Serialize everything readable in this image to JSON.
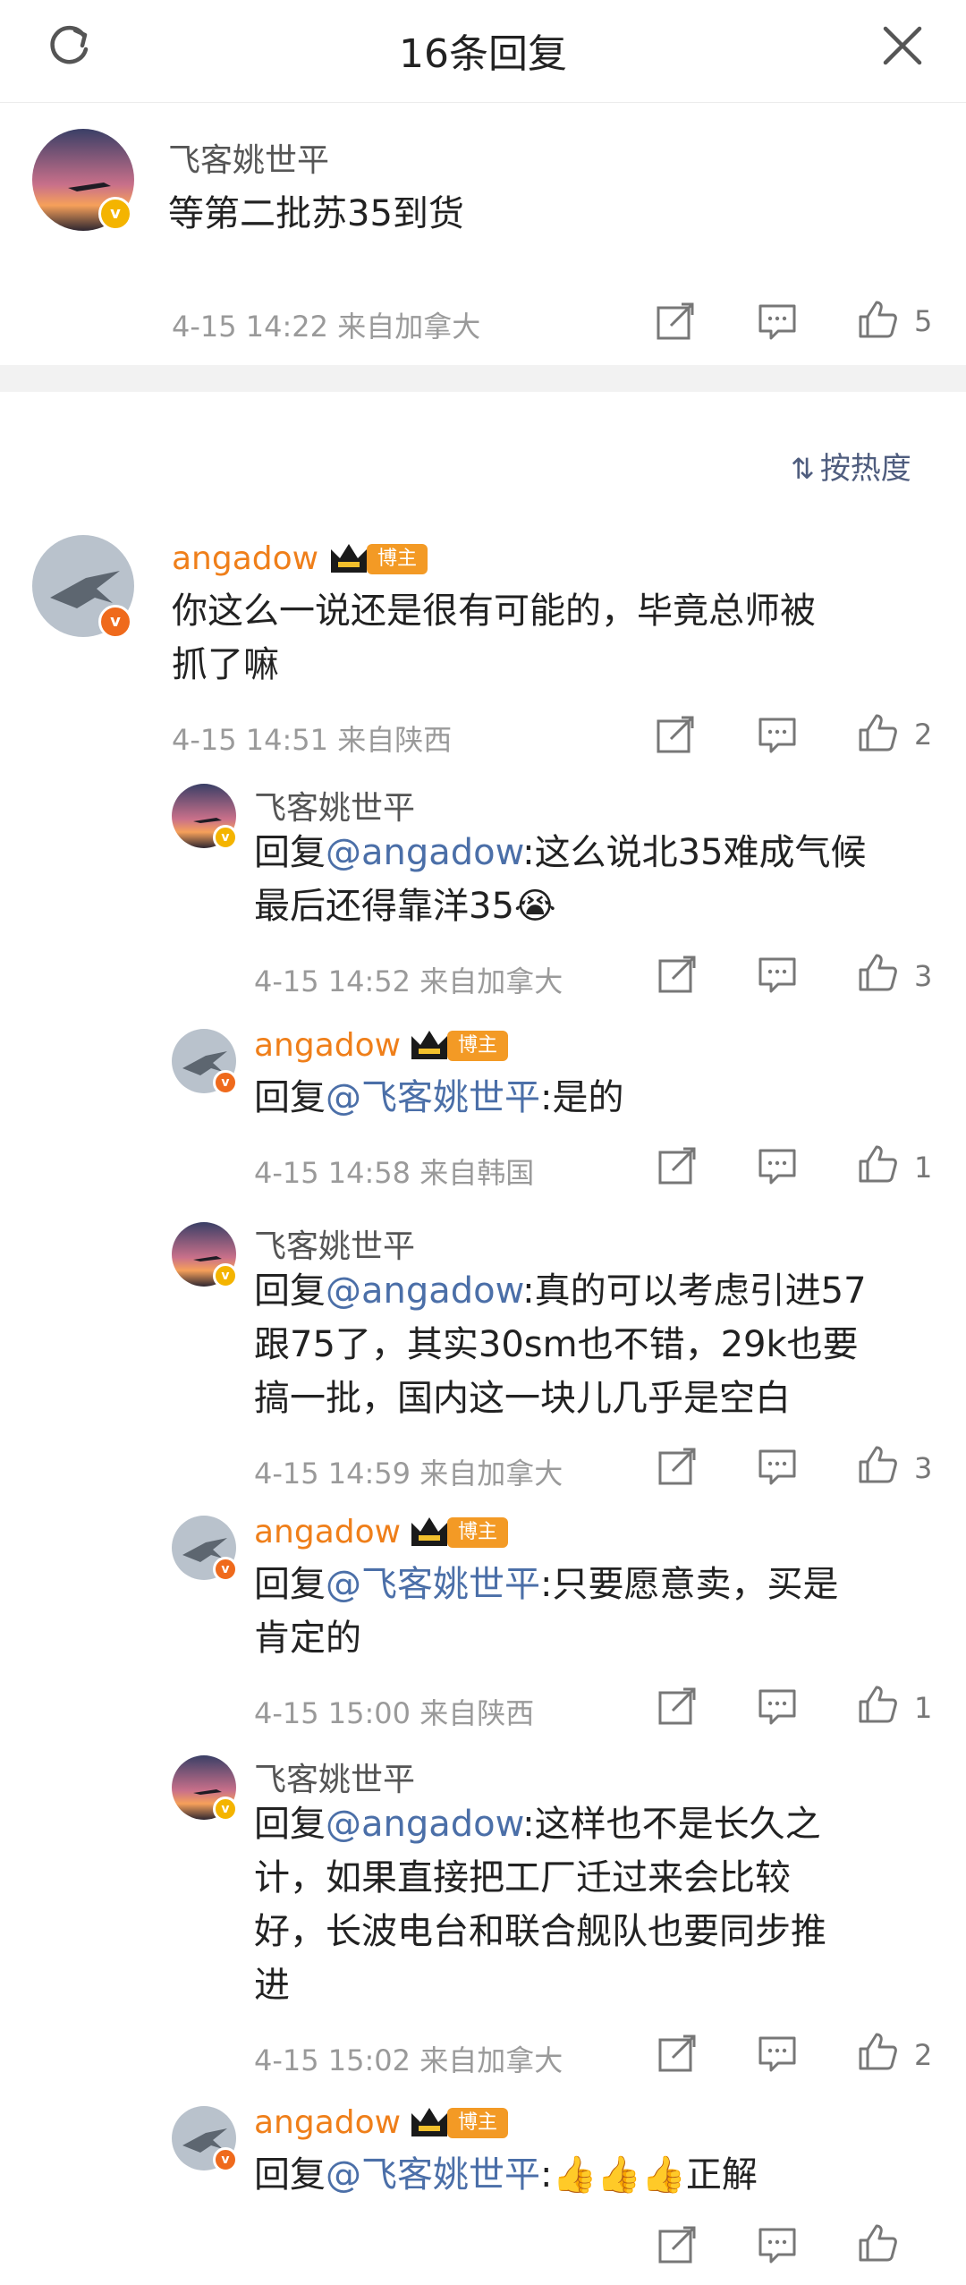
{
  "header": {
    "title": "16条回复",
    "refresh_icon": "refresh-icon",
    "close_icon": "close-icon"
  },
  "original": {
    "author": "飞客姚世平",
    "text": "等第二批苏35到货",
    "meta": "4-15 14:22  来自加拿大",
    "likes": "5"
  },
  "sort_label": "按热度",
  "badge": {
    "label": "博主"
  },
  "main_comment": {
    "author": "angadow",
    "text_line1": "你这么一说还是很有可能的，毕竟总师被",
    "text_line2": "抓了嘛",
    "meta": "4-15 14:51  来自陕西",
    "likes": "2"
  },
  "replies": [
    {
      "author": "飞客姚世平",
      "prefix": "回复",
      "at": "@angadow",
      "lines": [
        ":这么说北35难成气候",
        "最后还得靠洋35😭"
      ],
      "meta": "4-15 14:52  来自加拿大",
      "likes": "3"
    },
    {
      "author": "angadow",
      "prefix": "回复",
      "at": "@飞客姚世平",
      "lines": [
        ":是的"
      ],
      "meta": "4-15 14:58  来自韩国",
      "likes": "1"
    },
    {
      "author": "飞客姚世平",
      "prefix": "回复",
      "at": "@angadow",
      "lines": [
        ":真的可以考虑引进57",
        "跟75了，其实30sm也不错，29k也要",
        "搞一批，国内这一块儿几乎是空白"
      ],
      "meta": "4-15 14:59  来自加拿大",
      "likes": "3"
    },
    {
      "author": "angadow",
      "prefix": "回复",
      "at": "@飞客姚世平",
      "lines": [
        ":只要愿意卖，买是",
        "肯定的"
      ],
      "meta": "4-15 15:00  来自陕西",
      "likes": "1"
    },
    {
      "author": "飞客姚世平",
      "prefix": "回复",
      "at": "@angadow",
      "lines": [
        ":这样也不是长久之",
        "计，如果直接把工厂迁过来会比较",
        "好，长波电台和联合舰队也要同步推",
        "进"
      ],
      "meta": "4-15 15:02  来自加拿大",
      "likes": "2"
    },
    {
      "author": "angadow",
      "prefix": "回复",
      "at": "@飞客姚世平",
      "lines": [
        ":👍👍👍正解"
      ],
      "meta": "",
      "likes": ""
    }
  ]
}
